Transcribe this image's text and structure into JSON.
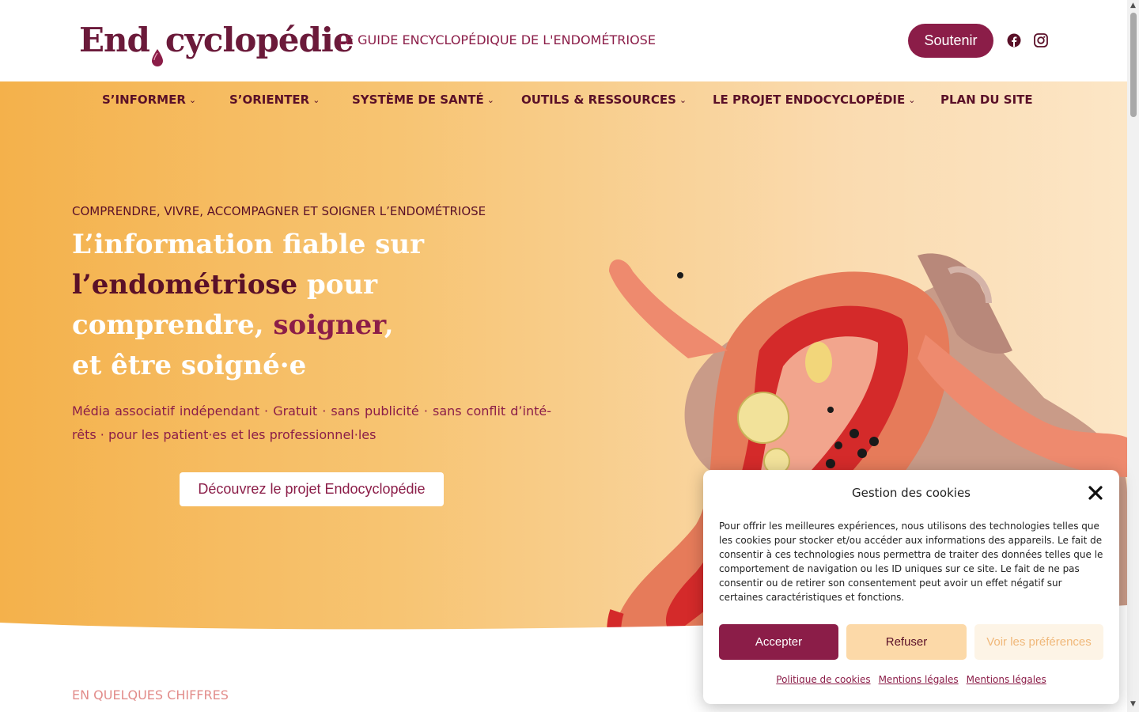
{
  "header": {
    "logo_text_left": "End",
    "logo_text_right": "cyclopédie",
    "tagline": "LE GUIDE ENCYCLOPÉDIQUE DE L'ENDOMÉTRIOSE",
    "support_label": "Soutenir",
    "icons": [
      "facebook-icon",
      "instagram-icon"
    ]
  },
  "nav": {
    "items": [
      {
        "label": "S’INFORMER",
        "dropdown": true
      },
      {
        "label": "S’ORIENTER",
        "dropdown": true
      },
      {
        "label": "SYSTÈME DE SANTÉ",
        "dropdown": true
      },
      {
        "label": "OUTILS & RESSOURCES",
        "dropdown": true
      },
      {
        "label": "LE PROJET ENDOCYCLOPÉDIE",
        "dropdown": true
      },
      {
        "label": "PLAN DU SITE",
        "dropdown": false
      }
    ],
    "chevron": "⌄"
  },
  "hero": {
    "overline": "COMPRENDRE, VIVRE, ACCOMPAGNER ET SOIGNER L’ENDOMÉTRIOSE",
    "headline": {
      "part1": "L’information fiable sur",
      "part2": "l’endométriose",
      "part3": " pour",
      "part4": "comprendre, ",
      "part5": "soigner",
      "part6": ",",
      "part7": "et être soigné·e"
    },
    "subtitle": "Média associatif indépendant · Gratuit · sans publicité · sans conflit d’inté­rêts · pour les patient·es et les professionnel·les",
    "cta_label": "Découvrez le projet Endocyclopédie"
  },
  "section": {
    "label": "EN QUELQUES CHIFFRES"
  },
  "cookie": {
    "title": "Gestion des cookies",
    "text": "Pour offrir les meilleures expériences, nous utilisons des technologies telles que les cookies pour stocker et/ou accéder aux informations des appareils. Le fait de consentir à ces technologies nous permettra de traiter des données telles que le comportement de navigation ou les ID uniques sur ce site. Le fait de ne pas consentir ou de retirer son consentement peut avoir un effet négatif sur certaines caractéristiques et fonctions.",
    "accept_label": "Accepter",
    "refuse_label": "Refuser",
    "prefs_label": "Voir les préférences",
    "links": [
      "Politique de cookies",
      "Mentions légales",
      "Mentions légales"
    ]
  },
  "colors": {
    "brand": "#8b1d48",
    "brand_dark": "#5a1028",
    "hero_start": "#f4b14b",
    "hero_end": "#fce6c6"
  }
}
